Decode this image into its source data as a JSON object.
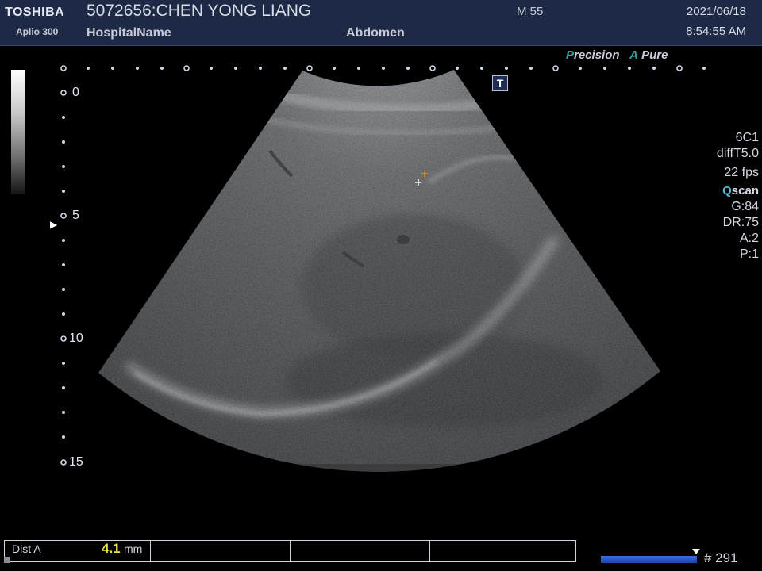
{
  "header": {
    "brand": "TOSHIBA",
    "model": "Aplio 300",
    "patient": "5072656:CHEN YONG LIANG",
    "hospital": "HospitalName",
    "exam": "Abdomen",
    "patient_info": "M 55",
    "date": "2021/06/18",
    "time": "8:54:55 AM"
  },
  "image_options": {
    "precision_label": "Precision",
    "precision_accent": "P",
    "precision_rest": "recision",
    "apure_accent": "A",
    "apure_rest": "Pure",
    "t_button": "T"
  },
  "depth_scale": {
    "labels": [
      "0",
      "5",
      "10",
      "15"
    ],
    "unit": "cm"
  },
  "params": {
    "probe": "6C1",
    "preset": "diffT5.0",
    "fps": "22 fps",
    "qscan_q": "Q",
    "qscan_rest": "scan",
    "gain": "G:84",
    "dynamic_range": "DR:75",
    "a": "A:2",
    "p": "P:1"
  },
  "measurement": {
    "label": "Dist A",
    "value": "4.1",
    "unit": "mm"
  },
  "cine": {
    "frame": "# 291"
  },
  "colors": {
    "header_bg": "#1e2a45",
    "accent_teal": "#2aa7a6",
    "measure_value": "#e9e34a",
    "cine_bar": "#2a5bc4",
    "caliper_orange": "#ff8a1e"
  },
  "icons": [
    "focus-marker-icon",
    "caliper-cross-icon",
    "t-icon"
  ]
}
